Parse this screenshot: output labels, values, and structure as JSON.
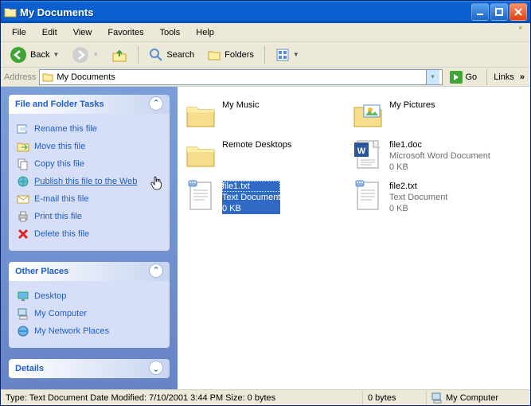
{
  "window": {
    "title": "My Documents"
  },
  "menu": {
    "file": "File",
    "edit": "Edit",
    "view": "View",
    "favorites": "Favorites",
    "tools": "Tools",
    "help": "Help"
  },
  "toolbar": {
    "back": "Back",
    "search": "Search",
    "folders": "Folders"
  },
  "address": {
    "label": "Address",
    "value": "My Documents",
    "go": "Go",
    "links": "Links"
  },
  "sidepane": {
    "tasks": {
      "title": "File and Folder Tasks",
      "items": [
        {
          "label": "Rename this file"
        },
        {
          "label": "Move this file"
        },
        {
          "label": "Copy this file"
        },
        {
          "label": "Publish this file to the Web"
        },
        {
          "label": "E-mail this file"
        },
        {
          "label": "Print this file"
        },
        {
          "label": "Delete this file"
        }
      ]
    },
    "places": {
      "title": "Other Places",
      "items": [
        {
          "label": "Desktop"
        },
        {
          "label": "My Computer"
        },
        {
          "label": "My Network Places"
        }
      ]
    },
    "details": {
      "title": "Details"
    }
  },
  "items": [
    {
      "name": "My Music",
      "type": "",
      "size": ""
    },
    {
      "name": "My Pictures",
      "type": "",
      "size": ""
    },
    {
      "name": "Remote Desktops",
      "type": "",
      "size": ""
    },
    {
      "name": "file1.doc",
      "type": "Microsoft Word Document",
      "size": "0 KB"
    },
    {
      "name": "file1.txt",
      "type": "Text Document",
      "size": "0 KB"
    },
    {
      "name": "file2.txt",
      "type": "Text Document",
      "size": "0 KB"
    }
  ],
  "status": {
    "main": "Type: Text Document Date Modified: 7/10/2001 3:44 PM Size: 0 bytes",
    "bytes": "0 bytes",
    "zone": "My Computer"
  }
}
